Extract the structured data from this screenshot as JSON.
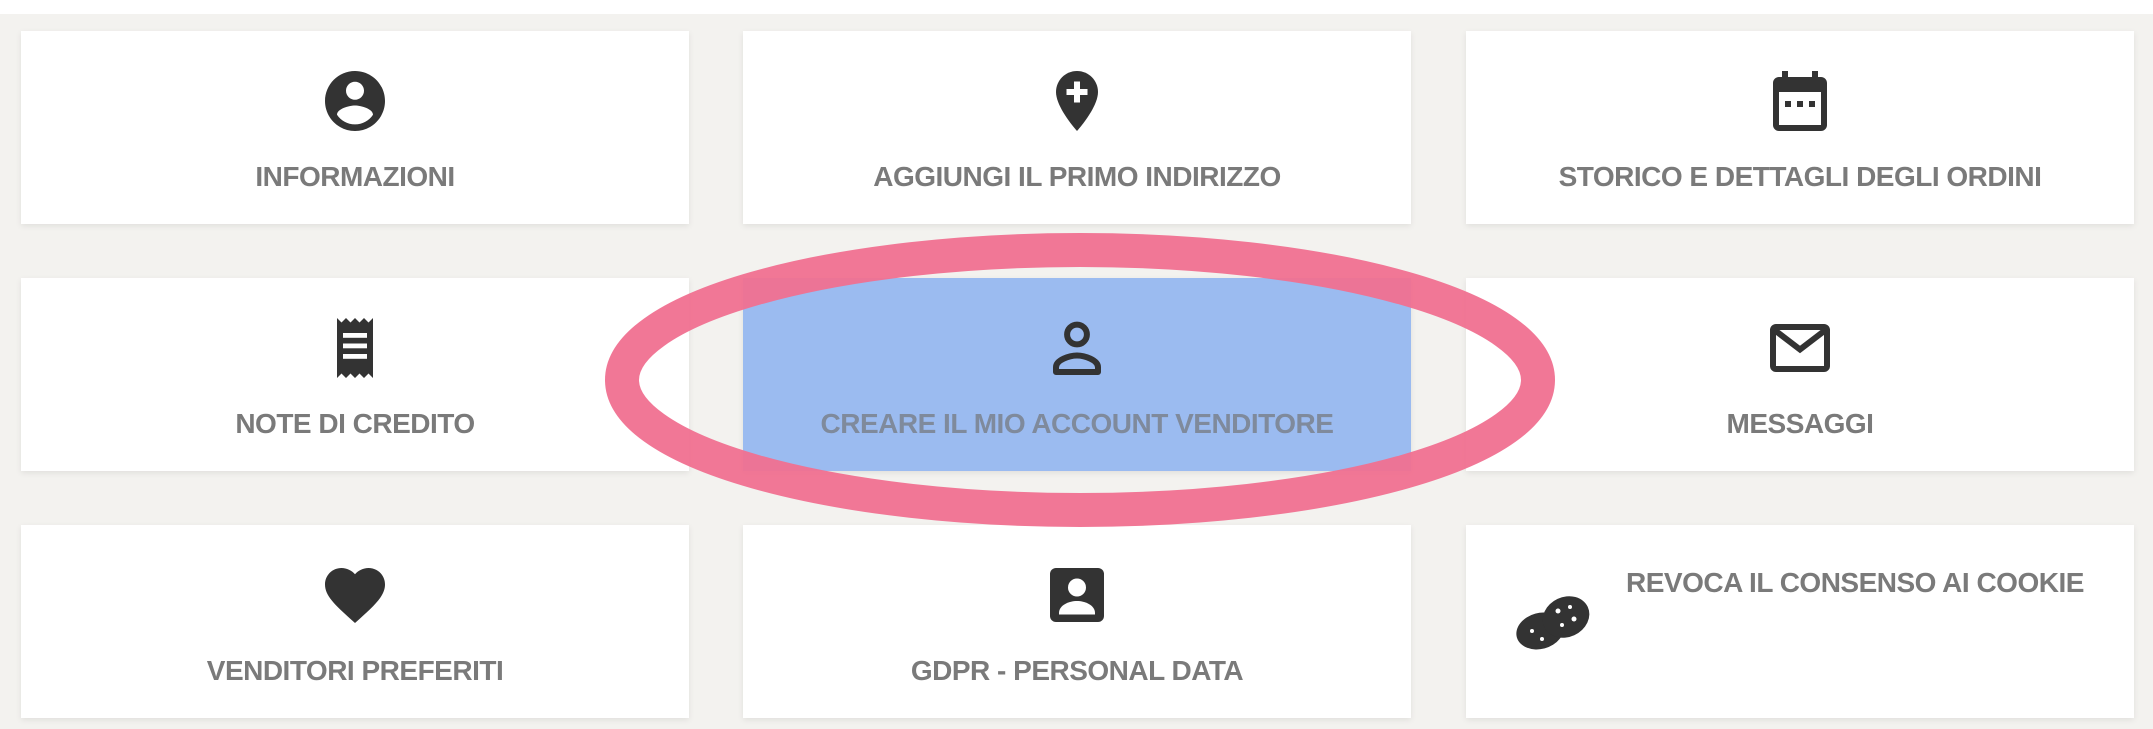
{
  "tiles": {
    "informazioni": {
      "label": "INFORMAZIONI",
      "icon": "account-circle-icon"
    },
    "indirizzo": {
      "label": "AGGIUNGI IL PRIMO INDIRIZZO",
      "icon": "add-location-icon"
    },
    "ordini": {
      "label": "STORICO E DETTAGLI DEGLI ORDINI",
      "icon": "calendar-icon"
    },
    "note": {
      "label": "NOTE DI CREDITO",
      "icon": "receipt-icon"
    },
    "venditore": {
      "label": "CREARE IL MIO ACCOUNT VENDITORE",
      "icon": "person-outline-icon"
    },
    "messaggi": {
      "label": "MESSAGGI",
      "icon": "mail-icon"
    },
    "preferiti": {
      "label": "VENDITORI PREFERITI",
      "icon": "heart-icon"
    },
    "gdpr": {
      "label": "GDPR - PERSONAL DATA",
      "icon": "contact-card-icon"
    },
    "cookie": {
      "label": "REVOCA IL CONSENSO AI COOKIE",
      "icon": "cookie-icon"
    }
  },
  "colors": {
    "panel_background": "#f3f2ef",
    "tile_background": "#ffffff",
    "label_text": "#7a7a7a",
    "icon": "#333333",
    "highlight_tile": "#9bbbf0",
    "annotation_ring": "#f07090"
  }
}
